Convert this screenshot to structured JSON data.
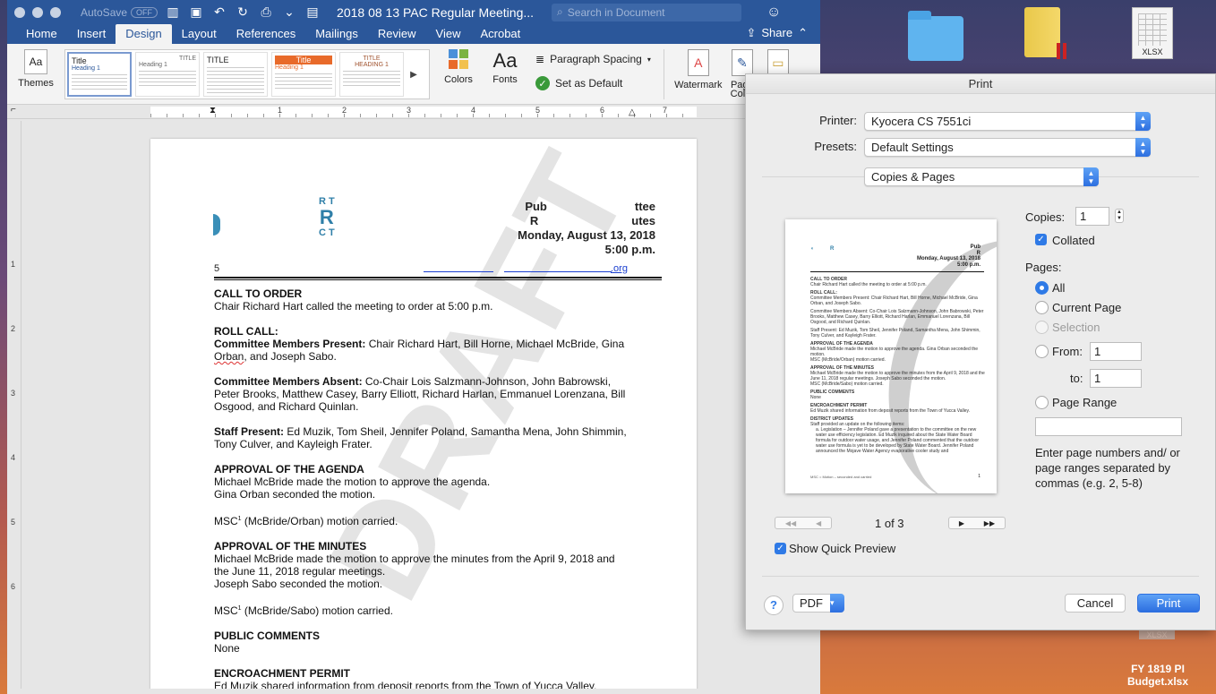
{
  "desktop": {
    "xlsx_label": "XLSX",
    "xlsx_label2": "XLSX",
    "file_label_line1": "FY 1819 PI",
    "file_label_line2": "Budget.xlsx"
  },
  "word": {
    "autosave_label": "AutoSave",
    "autosave_state": "OFF",
    "doc_title": "2018 08 13 PAC Regular Meeting...",
    "search_placeholder": "Search in Document",
    "tabs": [
      "Home",
      "Insert",
      "Design",
      "Layout",
      "References",
      "Mailings",
      "Review",
      "View",
      "Acrobat"
    ],
    "active_tab": "Design",
    "share_label": "Share",
    "ribbon": {
      "themes": "Themes",
      "colors": "Colors",
      "fonts": "Fonts",
      "paragraph_spacing": "Paragraph Spacing",
      "set_as_default": "Set as Default",
      "watermark": "Watermark",
      "page_color_line1": "Page",
      "page_color_line2": "Color",
      "style_title": "Title",
      "style_heading1": "Heading 1",
      "style_title_caps": "TITLE",
      "style_heading_caps": "HEADING 1"
    },
    "ruler_numbers": [
      "1",
      "2",
      "3",
      "4",
      "5",
      "6",
      "7"
    ],
    "vruler_numbers": [
      "1",
      "2",
      "3",
      "4",
      "5",
      "6"
    ]
  },
  "document": {
    "logo_letters": [
      "R T",
      "R",
      "C T"
    ],
    "header_lines": [
      "Pub",
      "ttee",
      "R",
      "utes",
      "Monday, August 13, 2018",
      "5:00 p.m."
    ],
    "contact_start": "5",
    "contact_link_end": ".org",
    "watermark": "DRAFT",
    "sections": {
      "call_to_order_h": "CALL TO ORDER",
      "call_to_order": "Chair Richard Hart called the meeting to order at 5:00 p.m.",
      "roll_call_h": "ROLL CALL:",
      "present_label": "Committee Members Present:",
      "present_text_1": " Chair Richard Hart, Bill Horne, Michael McBride, Gina",
      "present_text_2a": "Orban",
      "present_text_2b": ", and Joseph Sabo.",
      "absent_label": "Committee Members Absent:",
      "absent_text_1": " Co-Chair Lois Salzmann-Johnson, John Babrowski,",
      "absent_text_2": "Peter Brooks, Matthew Casey, Barry Elliott, Richard Harlan, Emmanuel Lorenzana, Bill",
      "absent_text_3": "Osgood, and Richard Quinlan.",
      "staff_label": "Staff Present:",
      "staff_text_1": " Ed Muzik, Tom Sheil, Jennifer Poland, Samantha Mena, John Shimmin,",
      "staff_text_2": "Tony Culver, and Kayleigh Frater.",
      "agenda_h": "APPROVAL OF THE AGENDA",
      "agenda_1": "Michael McBride made the motion to approve the agenda.",
      "agenda_2": "Gina Orban seconded the motion.",
      "agenda_msc_a": "MSC",
      "agenda_msc_sup": "1",
      "agenda_msc_b": " (McBride/Orban) motion carried.",
      "minutes_h": "APPROVAL OF THE MINUTES",
      "minutes_1": "Michael McBride made the motion to approve the minutes from the April 9, 2018 and",
      "minutes_2": "the June 11, 2018 regular meetings.",
      "minutes_3": "Joseph Sabo seconded the motion.",
      "minutes_msc_a": "MSC",
      "minutes_msc_sup": "1",
      "minutes_msc_b": " (McBride/Sabo) motion carried.",
      "public_h": "PUBLIC COMMENTS",
      "public_1": "None",
      "encroach_h": "ENCROACHMENT PERMIT",
      "encroach_1": "Ed Muzik shared information from deposit reports from the Town of Yucca Valley."
    }
  },
  "print": {
    "title": "Print",
    "printer_label": "Printer:",
    "printer_value": "Kyocera CS 7551ci",
    "presets_label": "Presets:",
    "presets_value": "Default Settings",
    "section_value": "Copies & Pages",
    "copies_label": "Copies:",
    "copies_value": "1",
    "collated_label": "Collated",
    "pages_label": "Pages:",
    "opt_all": "All",
    "opt_current": "Current Page",
    "opt_selection": "Selection",
    "opt_from": "From:",
    "from_value": "1",
    "to_label": "to:",
    "to_value": "1",
    "opt_range": "Page Range",
    "range_help": "Enter page numbers and/ or page ranges separated by commas (e.g. 2, 5-8)",
    "page_indicator": "1 of 3",
    "show_quick_preview": "Show Quick Preview",
    "help": "?",
    "pdf": "PDF",
    "cancel": "Cancel",
    "print_btn": "Print",
    "preview": {
      "header": [
        "Pub",
        "R",
        "Monday, August 13, 2018",
        "5:00 p.m."
      ],
      "lines": [
        "CALL TO ORDER",
        "Chair Richard Hart called the meeting to order at 5:00 p.m.",
        "ROLL CALL:",
        "Committee Members Present: Chair Richard Hart, Bill Horne, Michael McBride, Gina Orban, and Joseph Sabo.",
        "Committee Members Absent: Co-Chair Lois Salzmann-Johnson, John Babrowski, Peter Brooks, Matthew Casey, Barry Elliott, Richard Harlan, Emmanuel Lorenzana, Bill Osgood, and Richard Quinlan.",
        "Staff Present: Ed Muzik, Tom Sheil, Jennifer Poland, Samantha Mena, John Shimmin, Tony Culver, and Kayleigh Frater.",
        "APPROVAL OF THE AGENDA",
        "Michael McBride made the motion to approve the agenda. Gina Orban seconded the motion.",
        "MSC (McBride/Orban) motion carried.",
        "APPROVAL OF THE MINUTES",
        "Michael McBride made the motion to approve the minutes from the April 9, 2018 and the June 11, 2018 regular meetings. Joseph Sabo seconded the motion.",
        "MSC (McBride/Sabo) motion carried.",
        "PUBLIC COMMENTS",
        "None",
        "ENCROACHMENT PERMIT",
        "Ed Muzik shared information from deposit reports from the Town of Yucca Valley.",
        "DISTRICT UPDATES",
        "Staff provided an update on the following items:",
        "a. Legislation – Jennifer Poland gave a presentation to the committee on the new water use efficiency legislation. Ed Muzik inquired about the State Water Board formula for outdoor water usage, and Jennifer Poland commented that the outdoor water use formula is yet to be developed by State Water Board. Jennifer Poland announced the Mojave Water Agency evaporative cooler study and"
      ],
      "footer_left": "MSC = Motion – seconded and carried",
      "footer_right": "1"
    }
  }
}
